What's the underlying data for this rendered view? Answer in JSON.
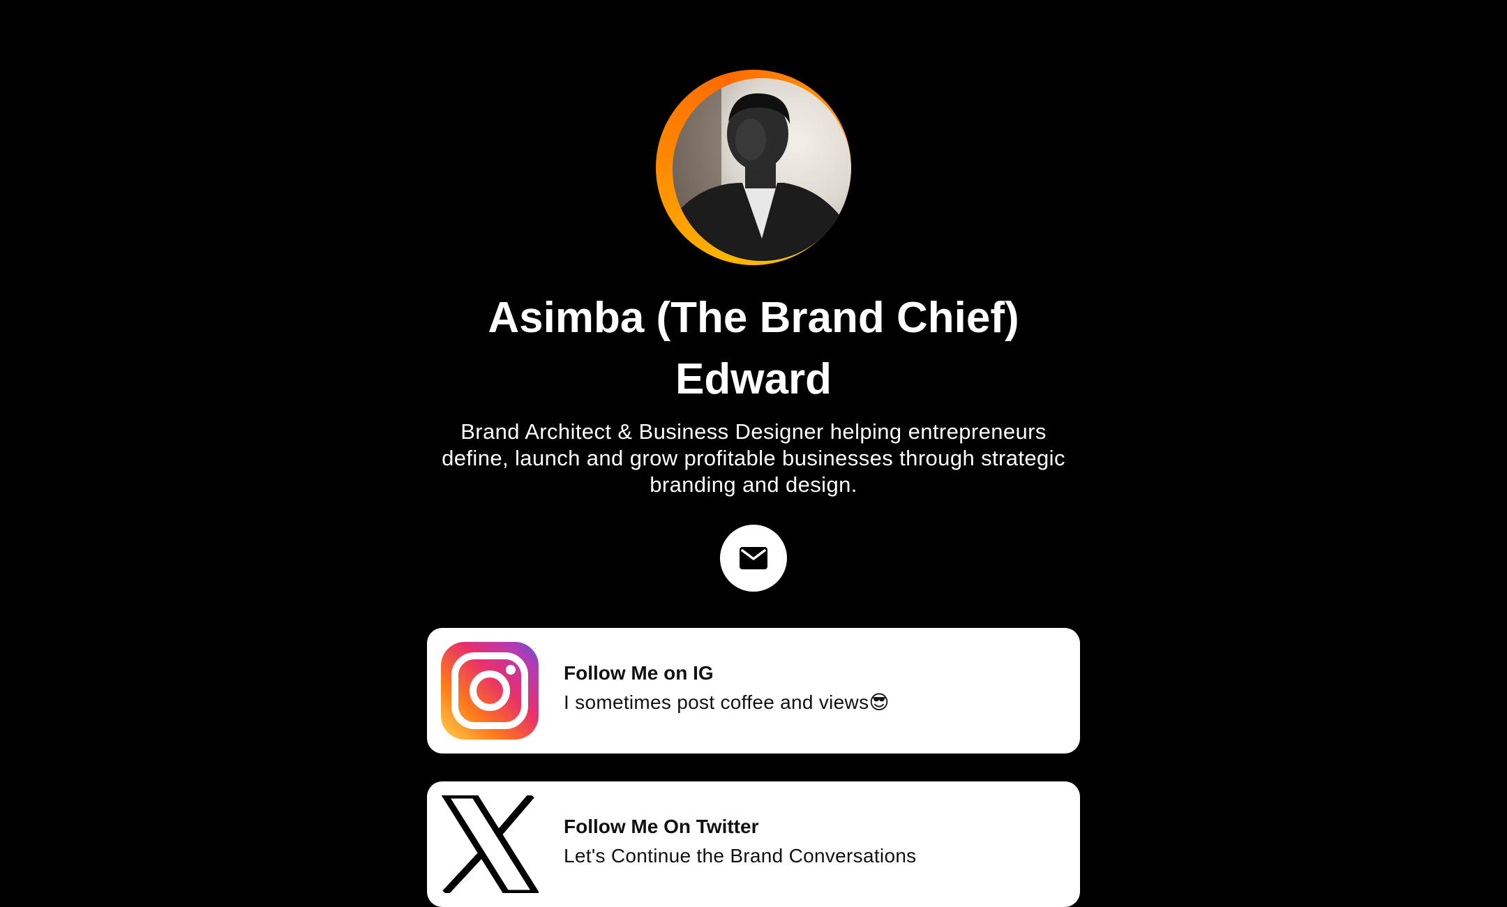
{
  "profile": {
    "name": "Asimba (The Brand Chief) Edward",
    "bio": "Brand Architect & Business Designer helping entrepreneurs define, launch and grow profitable businesses through strategic branding and design."
  },
  "contact": {
    "email_icon": "mail-icon"
  },
  "links": [
    {
      "title": "Follow Me on IG",
      "description": "I sometimes post coffee and views😎",
      "icon": "instagram-icon"
    },
    {
      "title": "Follow Me On Twitter",
      "description": "Let's Continue the Brand Conversations",
      "icon": "x-twitter-icon"
    }
  ],
  "colors": {
    "background": "#000000",
    "card": "#ffffff",
    "avatar_ring": "#ff9800"
  }
}
